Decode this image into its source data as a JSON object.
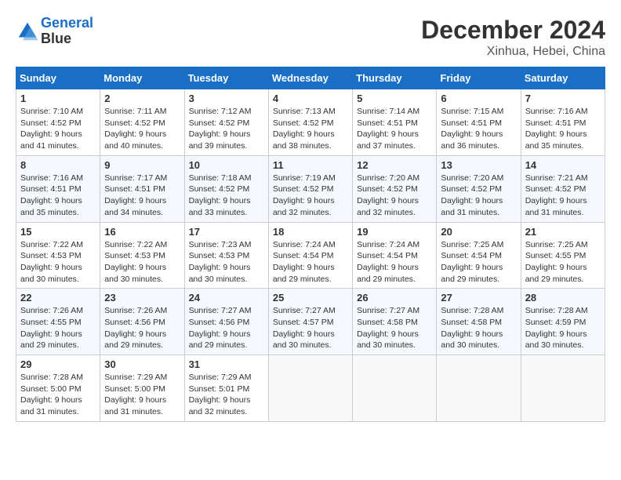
{
  "header": {
    "logo_line1": "General",
    "logo_line2": "Blue",
    "month_title": "December 2024",
    "location": "Xinhua, Hebei, China"
  },
  "weekdays": [
    "Sunday",
    "Monday",
    "Tuesday",
    "Wednesday",
    "Thursday",
    "Friday",
    "Saturday"
  ],
  "weeks": [
    [
      {
        "day": "1",
        "sunrise": "7:10 AM",
        "sunset": "4:52 PM",
        "daylight": "9 hours and 41 minutes."
      },
      {
        "day": "2",
        "sunrise": "7:11 AM",
        "sunset": "4:52 PM",
        "daylight": "9 hours and 40 minutes."
      },
      {
        "day": "3",
        "sunrise": "7:12 AM",
        "sunset": "4:52 PM",
        "daylight": "9 hours and 39 minutes."
      },
      {
        "day": "4",
        "sunrise": "7:13 AM",
        "sunset": "4:52 PM",
        "daylight": "9 hours and 38 minutes."
      },
      {
        "day": "5",
        "sunrise": "7:14 AM",
        "sunset": "4:51 PM",
        "daylight": "9 hours and 37 minutes."
      },
      {
        "day": "6",
        "sunrise": "7:15 AM",
        "sunset": "4:51 PM",
        "daylight": "9 hours and 36 minutes."
      },
      {
        "day": "7",
        "sunrise": "7:16 AM",
        "sunset": "4:51 PM",
        "daylight": "9 hours and 35 minutes."
      }
    ],
    [
      {
        "day": "8",
        "sunrise": "7:16 AM",
        "sunset": "4:51 PM",
        "daylight": "9 hours and 35 minutes."
      },
      {
        "day": "9",
        "sunrise": "7:17 AM",
        "sunset": "4:51 PM",
        "daylight": "9 hours and 34 minutes."
      },
      {
        "day": "10",
        "sunrise": "7:18 AM",
        "sunset": "4:52 PM",
        "daylight": "9 hours and 33 minutes."
      },
      {
        "day": "11",
        "sunrise": "7:19 AM",
        "sunset": "4:52 PM",
        "daylight": "9 hours and 32 minutes."
      },
      {
        "day": "12",
        "sunrise": "7:20 AM",
        "sunset": "4:52 PM",
        "daylight": "9 hours and 32 minutes."
      },
      {
        "day": "13",
        "sunrise": "7:20 AM",
        "sunset": "4:52 PM",
        "daylight": "9 hours and 31 minutes."
      },
      {
        "day": "14",
        "sunrise": "7:21 AM",
        "sunset": "4:52 PM",
        "daylight": "9 hours and 31 minutes."
      }
    ],
    [
      {
        "day": "15",
        "sunrise": "7:22 AM",
        "sunset": "4:53 PM",
        "daylight": "9 hours and 30 minutes."
      },
      {
        "day": "16",
        "sunrise": "7:22 AM",
        "sunset": "4:53 PM",
        "daylight": "9 hours and 30 minutes."
      },
      {
        "day": "17",
        "sunrise": "7:23 AM",
        "sunset": "4:53 PM",
        "daylight": "9 hours and 30 minutes."
      },
      {
        "day": "18",
        "sunrise": "7:24 AM",
        "sunset": "4:54 PM",
        "daylight": "9 hours and 29 minutes."
      },
      {
        "day": "19",
        "sunrise": "7:24 AM",
        "sunset": "4:54 PM",
        "daylight": "9 hours and 29 minutes."
      },
      {
        "day": "20",
        "sunrise": "7:25 AM",
        "sunset": "4:54 PM",
        "daylight": "9 hours and 29 minutes."
      },
      {
        "day": "21",
        "sunrise": "7:25 AM",
        "sunset": "4:55 PM",
        "daylight": "9 hours and 29 minutes."
      }
    ],
    [
      {
        "day": "22",
        "sunrise": "7:26 AM",
        "sunset": "4:55 PM",
        "daylight": "9 hours and 29 minutes."
      },
      {
        "day": "23",
        "sunrise": "7:26 AM",
        "sunset": "4:56 PM",
        "daylight": "9 hours and 29 minutes."
      },
      {
        "day": "24",
        "sunrise": "7:27 AM",
        "sunset": "4:56 PM",
        "daylight": "9 hours and 29 minutes."
      },
      {
        "day": "25",
        "sunrise": "7:27 AM",
        "sunset": "4:57 PM",
        "daylight": "9 hours and 30 minutes."
      },
      {
        "day": "26",
        "sunrise": "7:27 AM",
        "sunset": "4:58 PM",
        "daylight": "9 hours and 30 minutes."
      },
      {
        "day": "27",
        "sunrise": "7:28 AM",
        "sunset": "4:58 PM",
        "daylight": "9 hours and 30 minutes."
      },
      {
        "day": "28",
        "sunrise": "7:28 AM",
        "sunset": "4:59 PM",
        "daylight": "9 hours and 30 minutes."
      }
    ],
    [
      {
        "day": "29",
        "sunrise": "7:28 AM",
        "sunset": "5:00 PM",
        "daylight": "9 hours and 31 minutes."
      },
      {
        "day": "30",
        "sunrise": "7:29 AM",
        "sunset": "5:00 PM",
        "daylight": "9 hours and 31 minutes."
      },
      {
        "day": "31",
        "sunrise": "7:29 AM",
        "sunset": "5:01 PM",
        "daylight": "9 hours and 32 minutes."
      },
      null,
      null,
      null,
      null
    ]
  ]
}
